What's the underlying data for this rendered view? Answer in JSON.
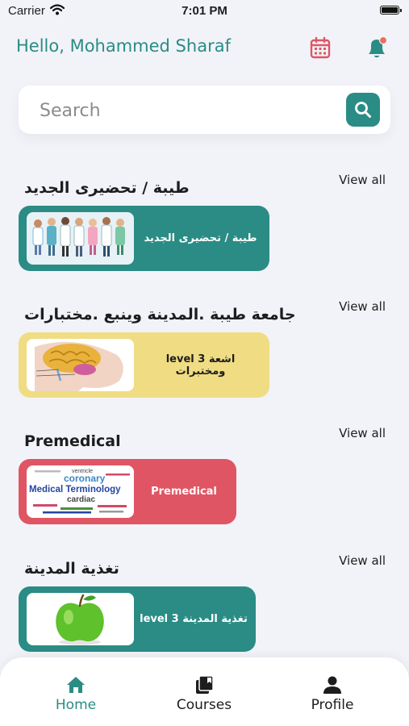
{
  "status_bar": {
    "carrier": "Carrier",
    "time": "7:01 PM"
  },
  "header": {
    "greeting": "Hello, Mohammed Sharaf"
  },
  "search": {
    "placeholder": "Search"
  },
  "colors": {
    "accent": "#2a8c85",
    "calendar": "#e05563",
    "notification_dot": "#ef6b5c"
  },
  "sections": [
    {
      "title": "طيبة / تحضيرى الجديد",
      "view_all": "View all",
      "card": {
        "title": "طيبة / تحضيرى الجديد",
        "color": "#2a8c85",
        "image": "doctors-group"
      }
    },
    {
      "title": "جامعة طيبة .المدينة وينبع .مختبارات",
      "view_all": "View all",
      "card": {
        "title": "level 3 اشعة ومختبرات",
        "color": "#f0dc82",
        "image": "brain-xray"
      }
    },
    {
      "title": "Premedical",
      "view_all": "View all",
      "card": {
        "title": "Premedical",
        "color": "#e05563",
        "image": "medical-terminology-wordcloud",
        "image_text": [
          "Medical Terminology",
          "coronary",
          "cardiac",
          "ventricle"
        ]
      }
    },
    {
      "title": "تغذية المدينة",
      "view_all": "View all",
      "card": {
        "title": "level 3 تغذية المدينة",
        "color": "#2a8c85",
        "image": "green-apple"
      }
    }
  ],
  "bottom_nav": [
    {
      "label": "Home",
      "icon": "home-icon",
      "active": true
    },
    {
      "label": "Courses",
      "icon": "courses-icon",
      "active": false
    },
    {
      "label": "Profile",
      "icon": "profile-icon",
      "active": false
    }
  ]
}
